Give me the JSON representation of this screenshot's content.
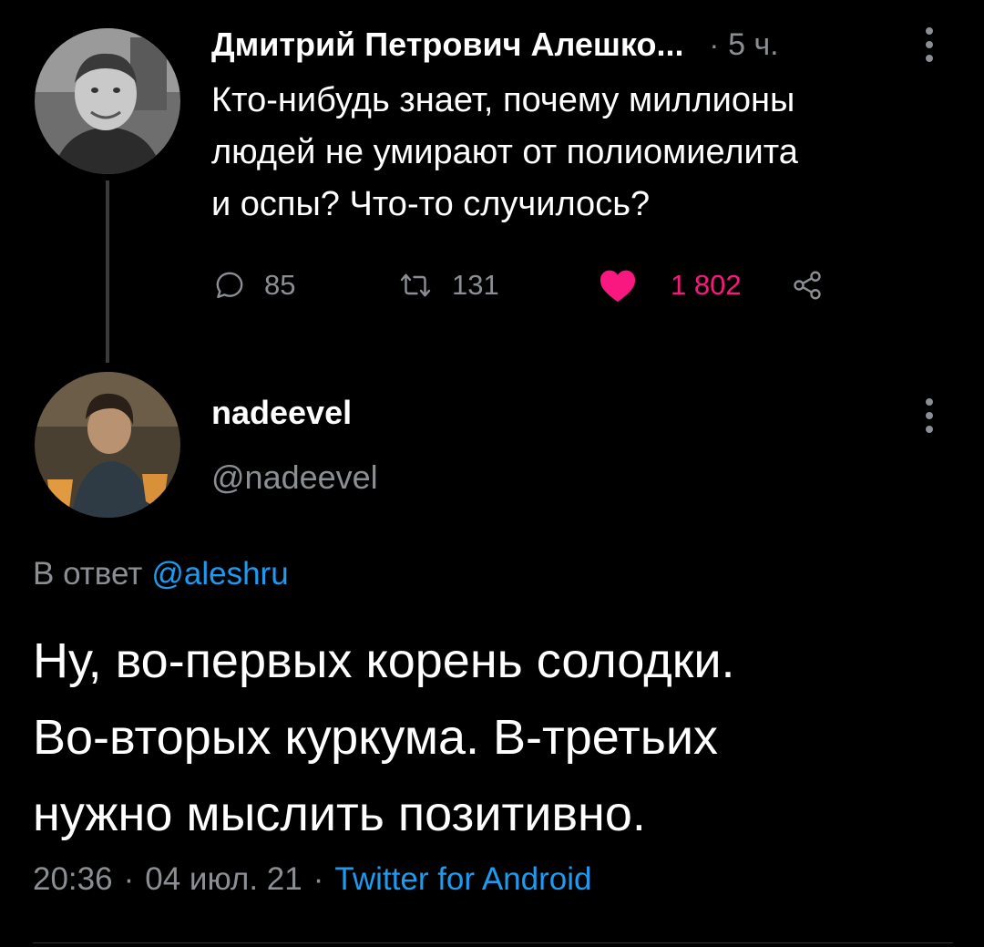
{
  "parent_tweet": {
    "author_name": "Дмитрий Петрович Алешко...",
    "separator": "·",
    "time_ago": "5 ч.",
    "text_lines": [
      "Кто-нибудь знает, почему миллионы",
      "людей не умирают от полиомиелита",
      "и оспы? Что-то случилось?"
    ],
    "actions": {
      "replies": "85",
      "retweets": "131",
      "likes": "1 802"
    },
    "icons": {
      "avatar": "user-avatar-photo",
      "reply": "comment-bubble-icon",
      "retweet": "retweet-arrows-icon",
      "like": "heart-icon-filled",
      "share": "share-icon",
      "more": "vertical-dots-icon"
    }
  },
  "reply_tweet": {
    "author_name": "nadeevel",
    "handle": "@nadeevel",
    "in_reply_prefix": "В ответ",
    "in_reply_mention": "@aleshru",
    "text_lines": [
      "Ну, во-первых корень солодки.",
      "Во-вторых куркума. В-третьих",
      "нужно мыслить позитивно."
    ],
    "time": "20:36",
    "separator": "·",
    "date": "04 июл. 21",
    "client": "Twitter for Android",
    "icons": {
      "avatar": "user-avatar-photo",
      "more": "vertical-dots-icon"
    }
  },
  "colors": {
    "background": "#000000",
    "primary_text": "#ffffff",
    "secondary_text": "#8b8f94",
    "link": "#1d9bf0",
    "like": "#f91880",
    "thread_line": "#3b3b3b"
  }
}
